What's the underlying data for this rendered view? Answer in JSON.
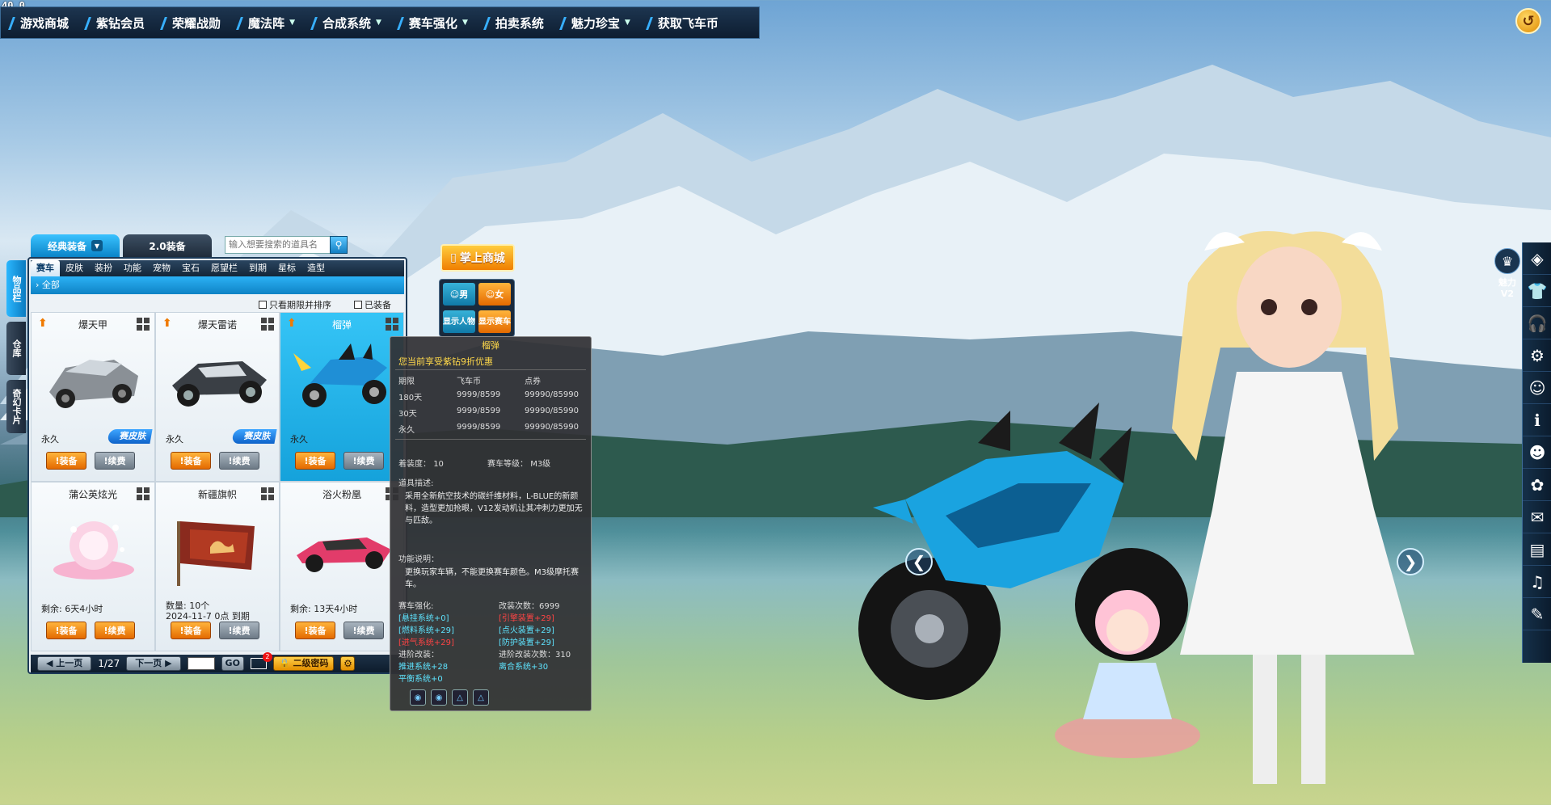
{
  "fps": "40.0",
  "topbar": {
    "items": [
      {
        "label": "游戏商城",
        "caret": false
      },
      {
        "label": "紫钻会员",
        "caret": false
      },
      {
        "label": "荣耀战勋",
        "caret": false
      },
      {
        "label": "魔法阵",
        "caret": true
      },
      {
        "label": "合成系统",
        "caret": true
      },
      {
        "label": "赛车强化",
        "caret": true
      },
      {
        "label": "拍卖系统",
        "caret": false
      },
      {
        "label": "魅力珍宝",
        "caret": true
      },
      {
        "label": "获取飞车币",
        "caret": false
      }
    ]
  },
  "charm": {
    "label": "魅力",
    "level": "V2"
  },
  "panel": {
    "top_tabs": [
      "经典装备",
      "2.0装备"
    ],
    "search_placeholder": "输入想要搜索的道具名",
    "side_tabs": [
      "物品栏",
      "仓库",
      "奇幻卡片"
    ],
    "cat_tabs": [
      "赛车",
      "皮肤",
      "装扮",
      "功能",
      "宠物",
      "宝石",
      "愿望栏",
      "到期",
      "星标",
      "造型"
    ],
    "sub_label": "全部",
    "filter_expiring": "只看期限并排序",
    "filter_equipped": "已装备",
    "items": [
      {
        "name": "爆天甲",
        "dur": "永久",
        "skin": "赛皮肤",
        "equip": "装备",
        "renew": "续费"
      },
      {
        "name": "爆天雷诺",
        "dur": "永久",
        "skin": "赛皮肤",
        "equip": "装备",
        "renew": "续费"
      },
      {
        "name": "榴弹",
        "dur": "永久",
        "skin": "",
        "equip": "装备",
        "renew": "续费"
      },
      {
        "name": "蒲公英炫光",
        "dur": "剩余: 6天4小时",
        "skin": "",
        "equip": "装备",
        "renew": "续费"
      },
      {
        "name": "新疆旗帜",
        "dur": "数量: 10个",
        "dur_line2": "2024-11-7 0点 到期",
        "skin": "",
        "equip": "装备",
        "renew": "续费"
      },
      {
        "name": "浴火粉凰",
        "dur": "剩余: 13天4小时",
        "skin": "",
        "equip": "装备",
        "renew": "续费"
      }
    ],
    "pager": {
      "prev": "上一页",
      "page": "1/27",
      "next": "下一页",
      "go": "GO",
      "mail_count": "2",
      "password": "二级密码"
    }
  },
  "mall": {
    "label": "掌上商城"
  },
  "gender": {
    "male": "男",
    "female": "女",
    "show_person": "显示人物",
    "show_car": "显示赛车"
  },
  "tooltip": {
    "title": "榴弹",
    "promo": "您当前享受紫钻9折优惠",
    "headers": [
      "期限",
      "飞车币",
      "点券"
    ],
    "rows": [
      [
        "180天",
        "9999/8599",
        "99990/85990"
      ],
      [
        "30天",
        "9999/8599",
        "99990/85990"
      ],
      [
        "永久",
        "9999/8599",
        "99990/85990"
      ]
    ],
    "wear_label": "着装度：",
    "wear_value": "10",
    "car_level_label": "赛车等级：",
    "car_level_value": "M3级",
    "desc_label": "道具描述:",
    "desc": "采用全新航空技术的碳纤维材料，L-BLUE的新颜料，造型更加抢眼，V12发动机让其冲刺力更加无与匹敌。",
    "func_label": "功能说明：",
    "func": "更换玩家车辆，不能更换赛车颜色。M3级摩托赛车。",
    "strength_label": "赛车强化:",
    "mod_count": "改装次数：6999",
    "left_stats": [
      "[悬挂系统+0]",
      "[燃料系统+29]",
      "[进气系统+29]"
    ],
    "right_stats": [
      "[引擎装置+29]",
      "[点火装置+29]",
      "[防护装置+29]"
    ],
    "adv_label": "进阶改装：",
    "adv_count": "进阶改装次数：310",
    "adv_left": [
      "推进系统+28",
      "平衡系统+0"
    ],
    "adv_right": [
      "离合系统+30"
    ]
  },
  "colors": {
    "accent": "#1aa3e0",
    "orange": "#f07f00",
    "panel_bg": "#edf2f6",
    "tooltip_bg": "#303034"
  }
}
